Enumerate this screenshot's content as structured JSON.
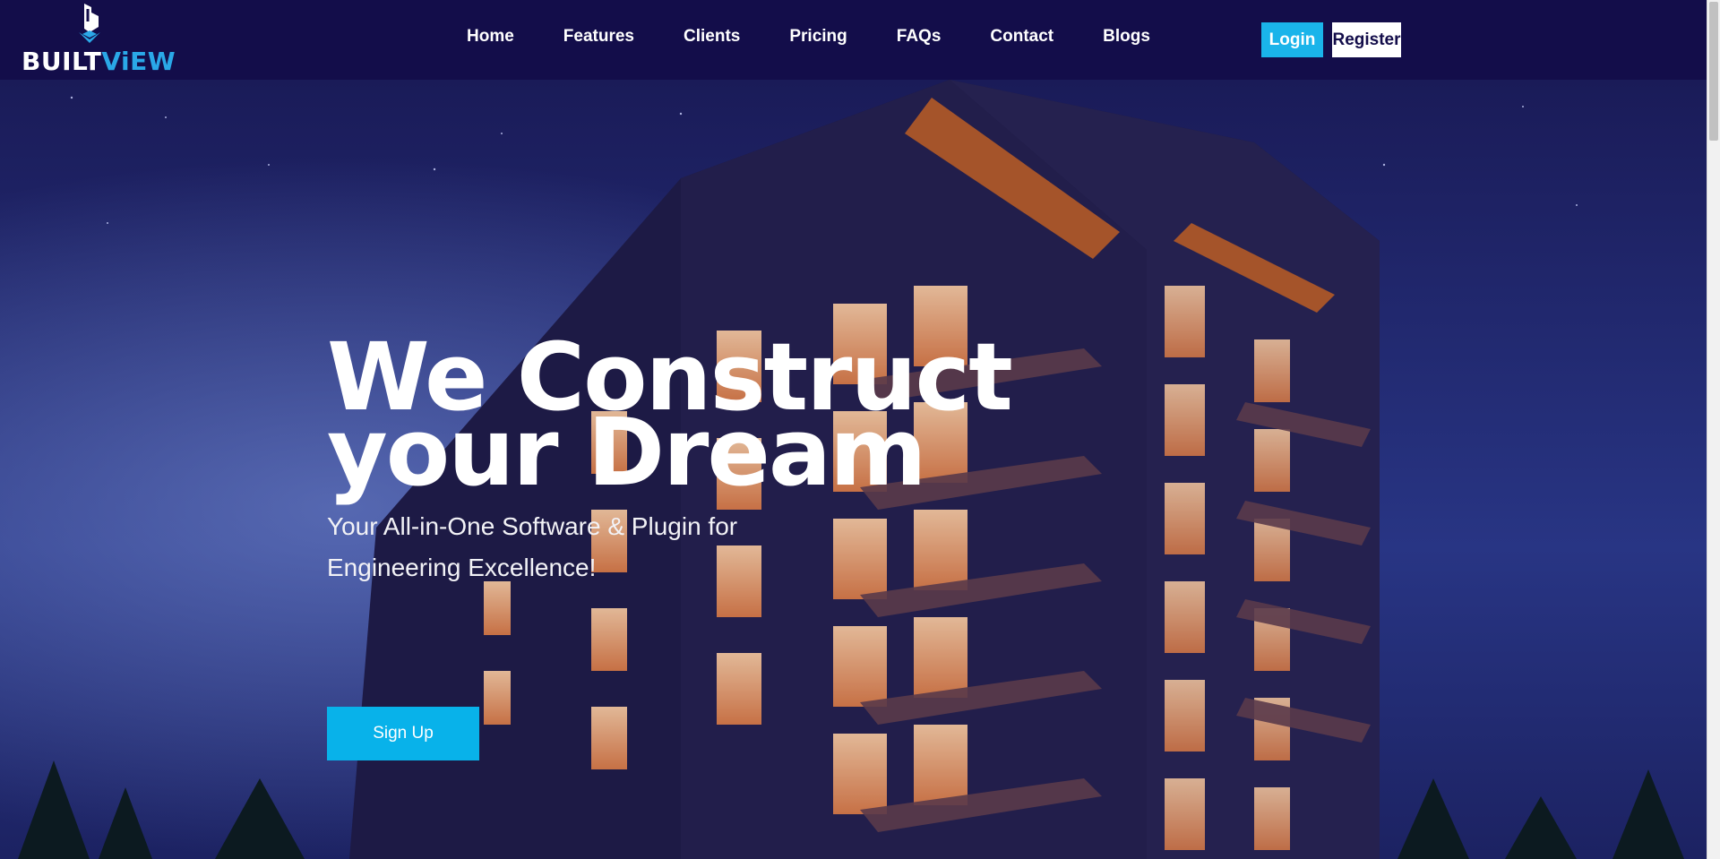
{
  "brand": {
    "name_part1": "BUILT",
    "name_part2": "ViEW",
    "accent_color": "#2aa8e8"
  },
  "nav": {
    "links": [
      {
        "label": "Home"
      },
      {
        "label": "Features"
      },
      {
        "label": "Clients"
      },
      {
        "label": "Pricing"
      },
      {
        "label": "FAQs"
      },
      {
        "label": "Contact"
      },
      {
        "label": "Blogs"
      }
    ],
    "login_label": "Login",
    "register_label": "Register"
  },
  "hero": {
    "title_line1": "We Construct",
    "title_line2": "your Dream",
    "subtitle": "Your All-in-One Software & Plugin for Engineering Excellence!",
    "cta_label": "Sign Up"
  },
  "colors": {
    "navbar_bg": "#130d4a",
    "primary_button": "#1ab4ea",
    "white": "#ffffff"
  }
}
